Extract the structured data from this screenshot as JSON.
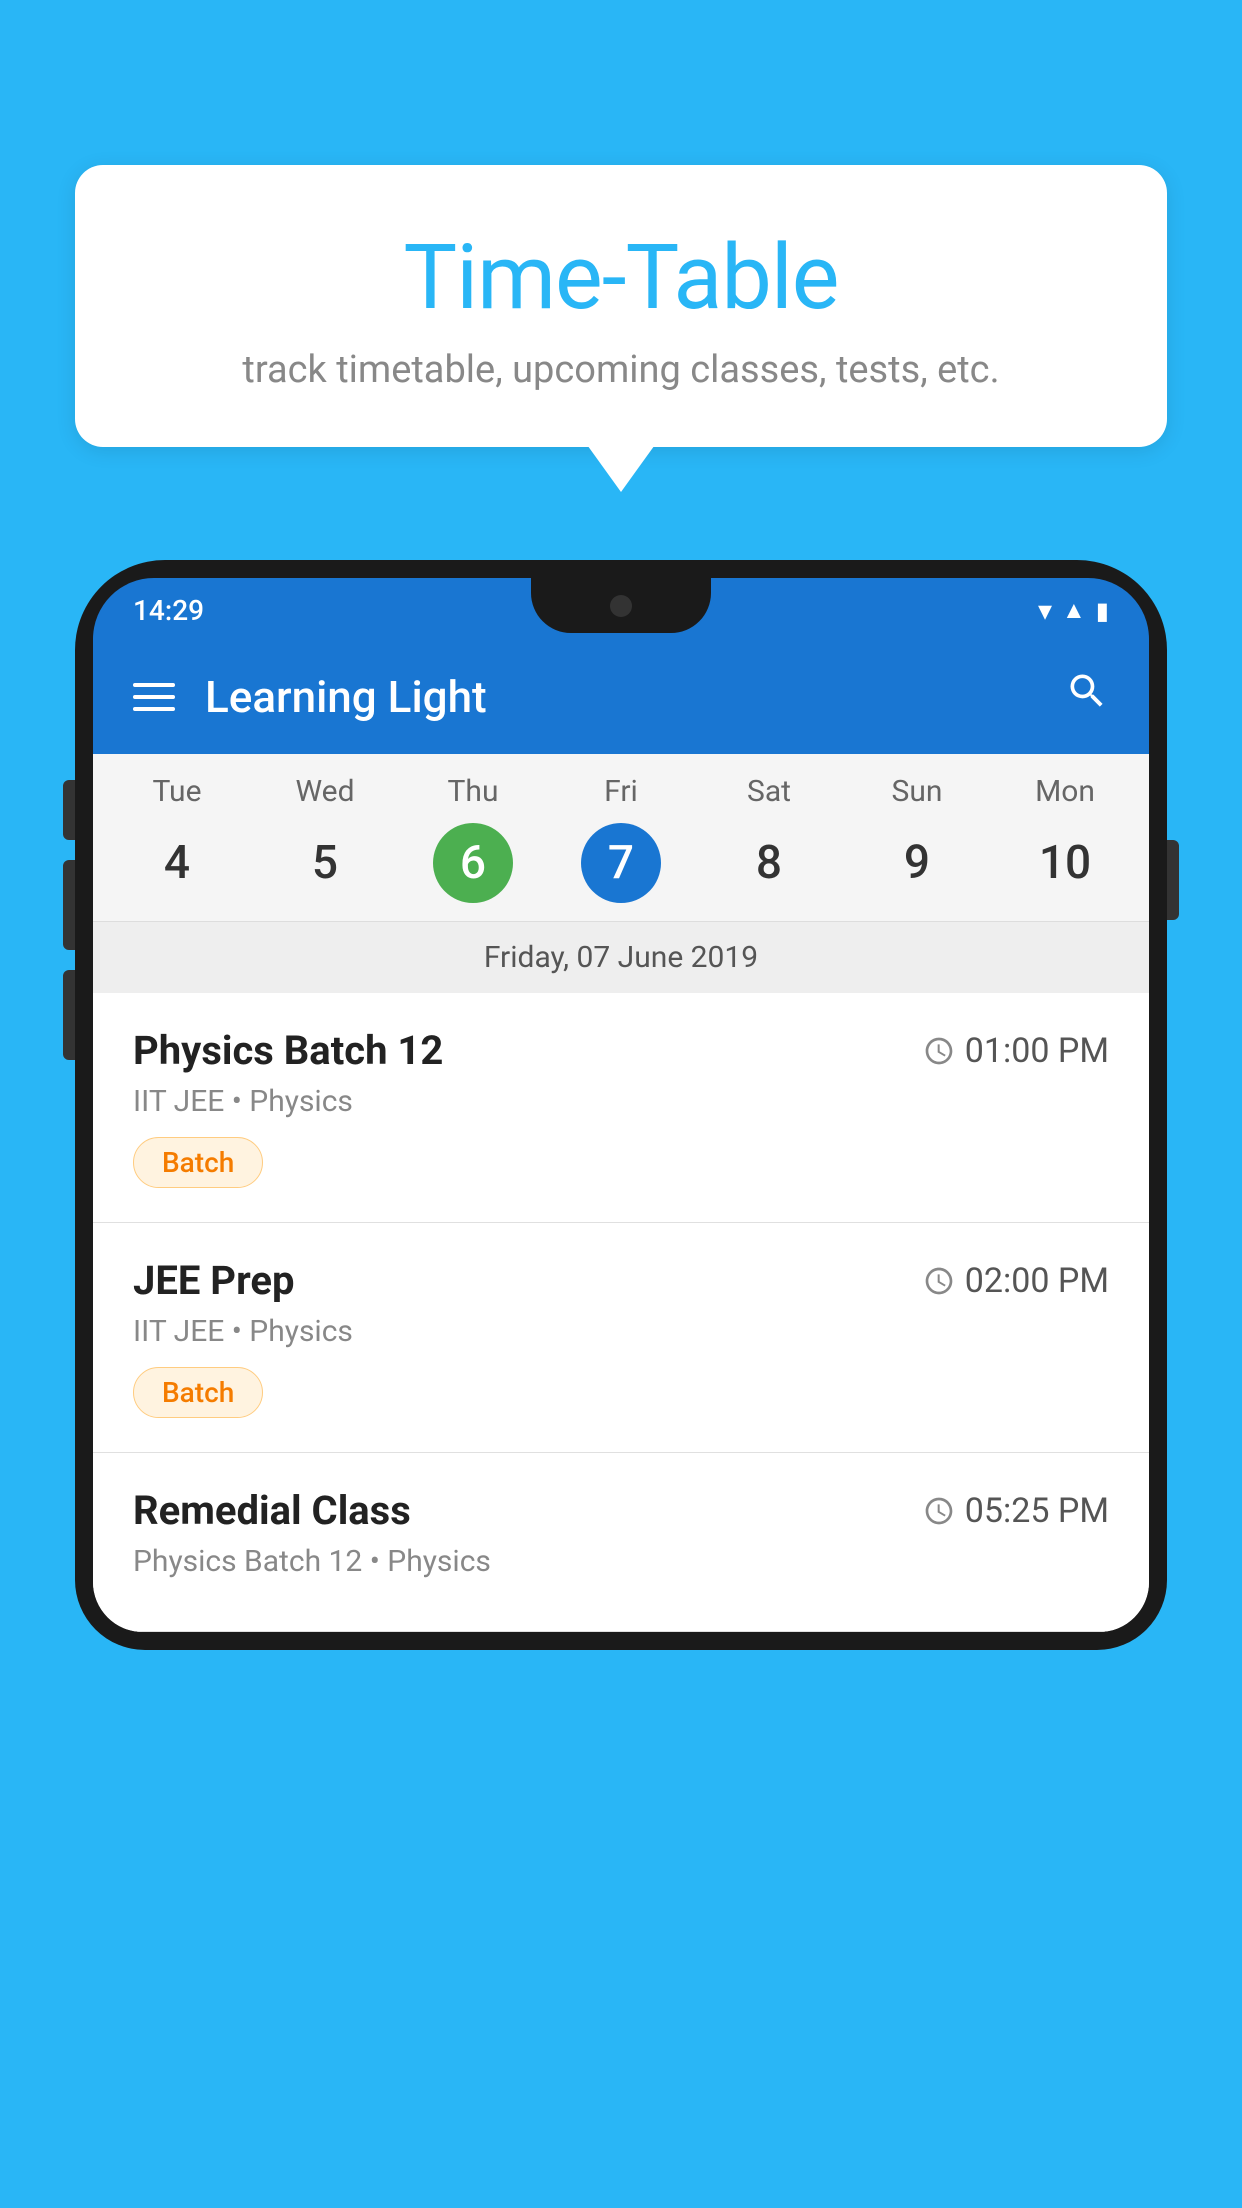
{
  "background_color": "#29B6F6",
  "bubble": {
    "title": "Time-Table",
    "subtitle": "track timetable, upcoming classes, tests, etc."
  },
  "status_bar": {
    "time": "14:29",
    "icons": [
      "wifi",
      "signal",
      "battery"
    ]
  },
  "app_bar": {
    "title": "Learning Light",
    "search_label": "search"
  },
  "calendar": {
    "days": [
      {
        "name": "Tue",
        "number": "4",
        "state": "normal"
      },
      {
        "name": "Wed",
        "number": "5",
        "state": "normal"
      },
      {
        "name": "Thu",
        "number": "6",
        "state": "today"
      },
      {
        "name": "Fri",
        "number": "7",
        "state": "selected"
      },
      {
        "name": "Sat",
        "number": "8",
        "state": "normal"
      },
      {
        "name": "Sun",
        "number": "9",
        "state": "normal"
      },
      {
        "name": "Mon",
        "number": "10",
        "state": "normal"
      }
    ],
    "selected_date_label": "Friday, 07 June 2019"
  },
  "schedule_items": [
    {
      "name": "Physics Batch 12",
      "time": "01:00 PM",
      "meta": "IIT JEE • Physics",
      "tag": "Batch"
    },
    {
      "name": "JEE Prep",
      "time": "02:00 PM",
      "meta": "IIT JEE • Physics",
      "tag": "Batch"
    },
    {
      "name": "Remedial Class",
      "time": "05:25 PM",
      "meta": "Physics Batch 12 • Physics",
      "tag": ""
    }
  ]
}
